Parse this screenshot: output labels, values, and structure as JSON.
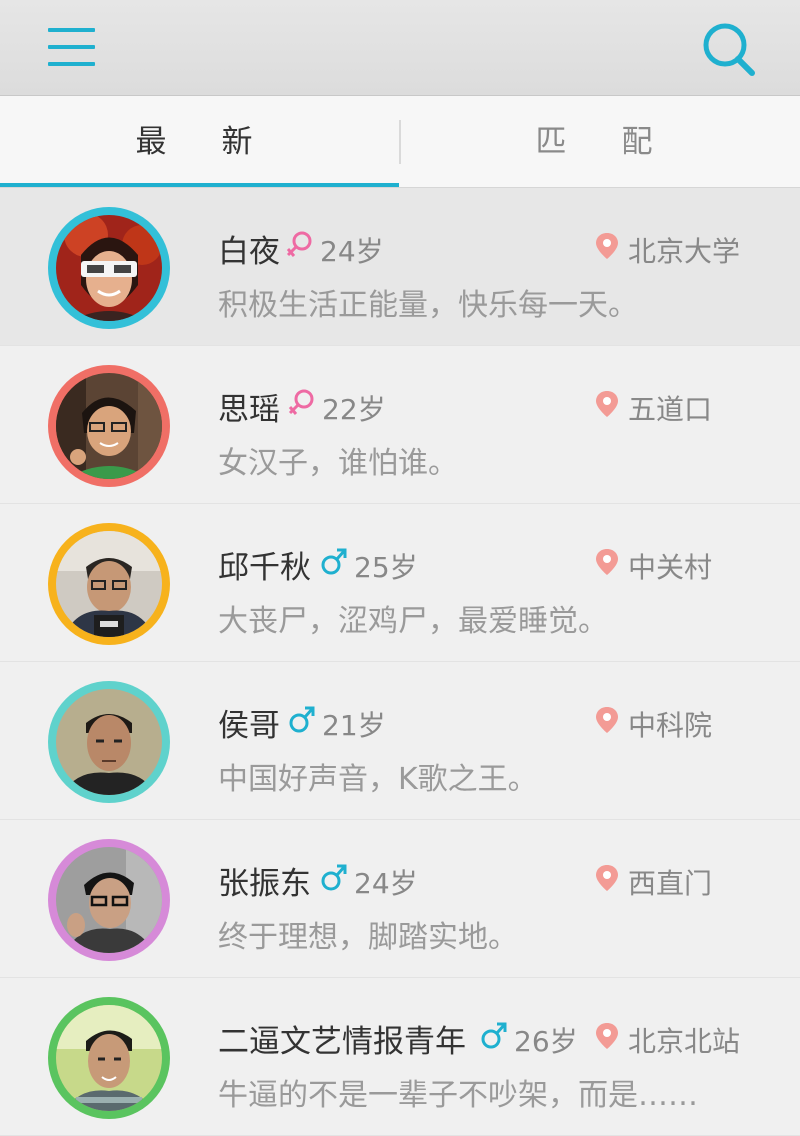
{
  "header": {
    "menu_icon": "hamburger-menu-icon",
    "search_icon": "search-icon",
    "accent": "#1fb0cf"
  },
  "tabs": [
    {
      "label": "最　新",
      "selected": true
    },
    {
      "label": "匹　配",
      "selected": false
    }
  ],
  "users": [
    {
      "name": "白夜",
      "gender": "female",
      "age": "24岁",
      "location": "北京大学",
      "bio": "积极生活正能量，快乐每一天。",
      "ring_color": "#33c0d8"
    },
    {
      "name": "思瑶",
      "gender": "female",
      "age": "22岁",
      "location": "五道口",
      "bio": "女汉子，谁怕谁。",
      "ring_color": "#f06f66"
    },
    {
      "name": "邱千秋",
      "gender": "male",
      "age": "25岁",
      "location": "中关村",
      "bio": "大丧尸，涩鸡尸，最爱睡觉。",
      "ring_color": "#f7b21c"
    },
    {
      "name": "侯哥",
      "gender": "male",
      "age": "21岁",
      "location": "中科院",
      "bio": "中国好声音，K歌之王。",
      "ring_color": "#5fd2cc"
    },
    {
      "name": "张振东",
      "gender": "male",
      "age": "24岁",
      "location": "西直门",
      "bio": "终于理想，脚踏实地。",
      "ring_color": "#d68ad8"
    },
    {
      "name": "二逼文艺情报青年",
      "gender": "male",
      "age": "26岁",
      "location": "北京北站",
      "bio": "牛逼的不是一辈子不吵架，而是……",
      "ring_color": "#5ac45f"
    }
  ],
  "colors": {
    "female": "#ee6aa3",
    "male": "#1fb0cf",
    "pin": "#f39b95"
  }
}
